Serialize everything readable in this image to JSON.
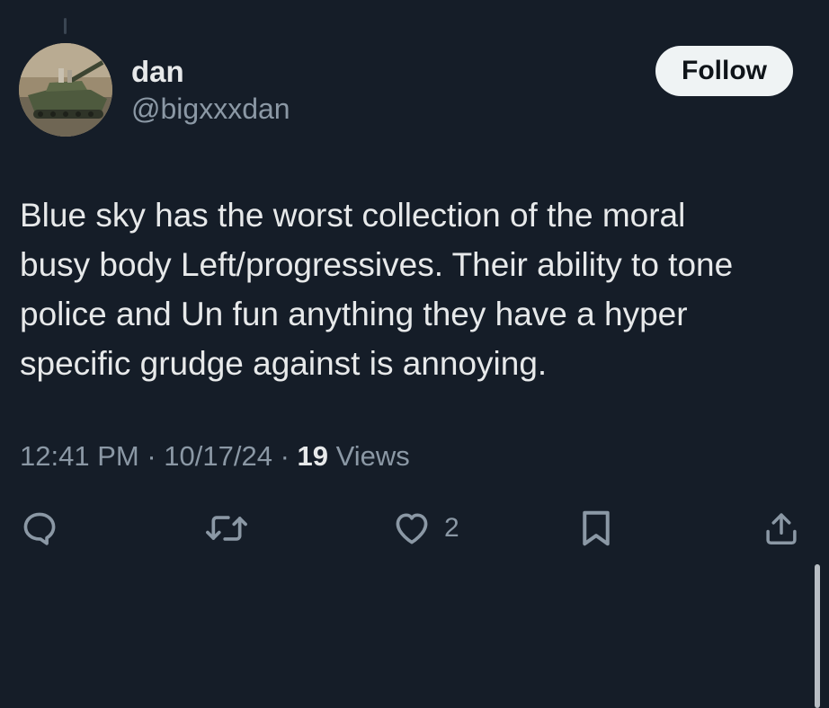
{
  "author": {
    "display_name": "dan",
    "handle": "@bigxxxdan",
    "avatar_icon": "tank-photo-avatar"
  },
  "follow_label": "Follow",
  "post": {
    "lines": [
      "Blue sky has the worst collection of the moral",
      "busy body Left/progressives. Their ability to tone",
      "police and Un fun anything they have a hyper",
      "specific grudge against is annoying."
    ]
  },
  "meta": {
    "time": "12:41 PM",
    "separator": "·",
    "date": "10/17/24",
    "views_count": "19",
    "views_label": "Views"
  },
  "actions": {
    "reply_icon": "reply-icon",
    "retweet_icon": "retweet-icon",
    "like_icon": "heart-icon",
    "like_count": "2",
    "bookmark_icon": "bookmark-icon",
    "share_icon": "share-icon"
  },
  "colors": {
    "background": "#151d28",
    "text_primary": "#e7e9ea",
    "text_secondary": "#8b98a5",
    "follow_bg": "#eff3f4"
  }
}
